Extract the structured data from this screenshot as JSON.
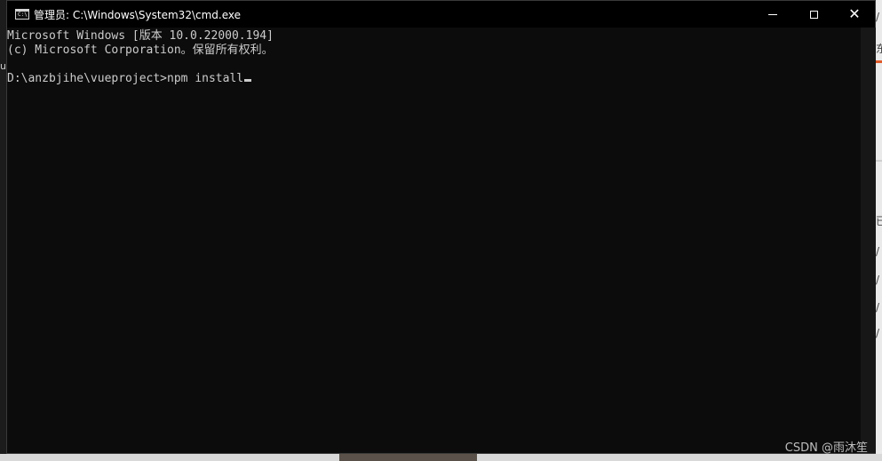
{
  "window": {
    "title": "管理员: C:\\Windows\\System32\\cmd.exe",
    "icon": "cmd-icon",
    "icon_text": "C:\\",
    "controls": {
      "minimize": "minimize-icon",
      "maximize": "maximize-icon",
      "close_glyph": "✕"
    }
  },
  "console": {
    "lines": [
      "Microsoft Windows [版本 10.0.22000.194]",
      "(c) Microsoft Corporation。保留所有权利。",
      "",
      "D:\\anzbjihe\\vueproject>npm install"
    ],
    "text_color": "#cccccc",
    "background": "#0c0c0c"
  },
  "background": {
    "left_edge_glyph": "ue",
    "right_edge_glyphs": [
      "/",
      "东",
      "已",
      "/",
      "/",
      "/",
      "/"
    ]
  },
  "watermark": "CSDN @雨沐笙"
}
